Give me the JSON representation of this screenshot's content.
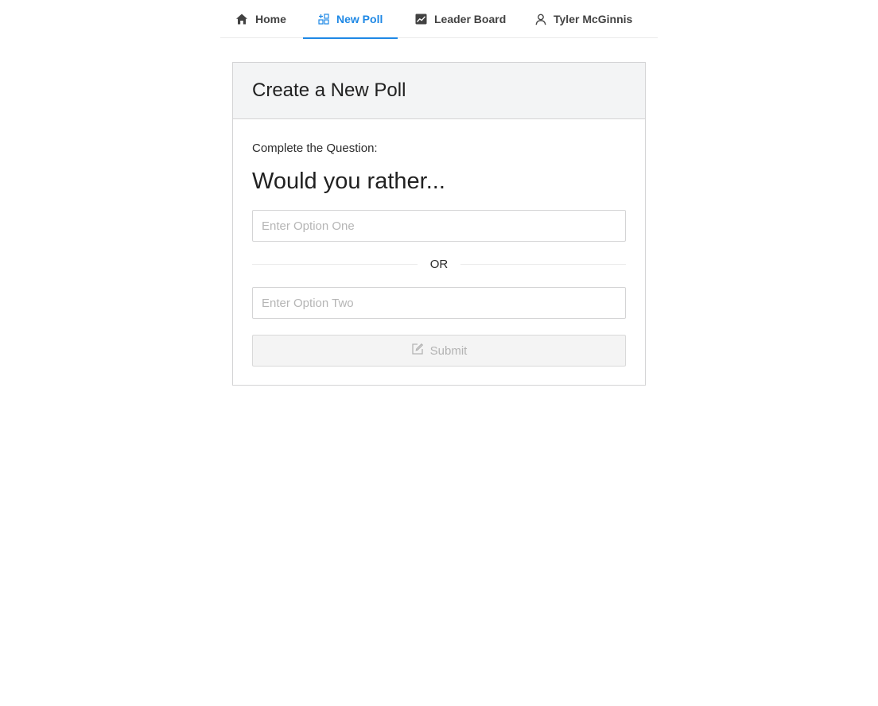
{
  "nav": {
    "home": {
      "label": "Home",
      "icon": "home-icon"
    },
    "new_poll": {
      "label": "New Poll",
      "icon": "grid-add-icon",
      "active": true
    },
    "leader_board": {
      "label": "Leader Board",
      "icon": "chart-line-icon"
    },
    "user": {
      "label": "Tyler McGinnis",
      "icon": "user-icon"
    }
  },
  "colors": {
    "accent": "#1e88e5",
    "text": "#212121",
    "header_bg": "#f3f4f5",
    "disabled_text": "#b3b3b3"
  },
  "card": {
    "title": "Create a New Poll",
    "prompt": "Complete the Question:",
    "headline": "Would you rather...",
    "option_one": {
      "value": "",
      "placeholder": "Enter Option One"
    },
    "divider_text": "OR",
    "option_two": {
      "value": "",
      "placeholder": "Enter Option Two"
    },
    "submit": {
      "label": "Submit",
      "icon": "edit-icon",
      "disabled": true
    }
  }
}
